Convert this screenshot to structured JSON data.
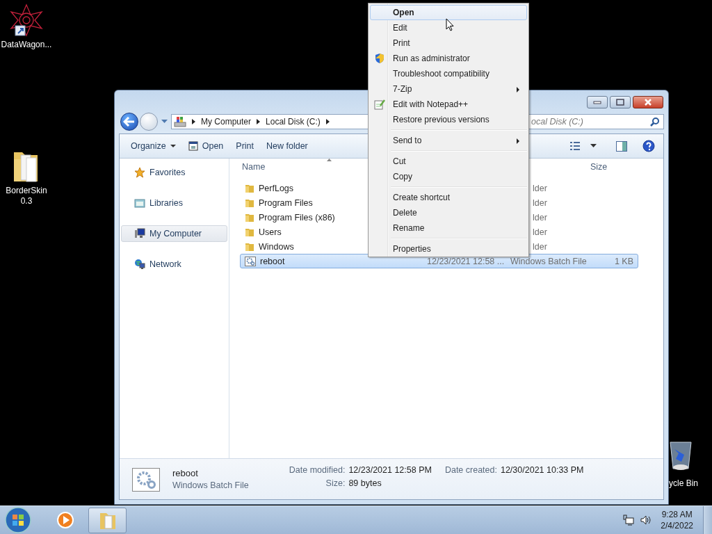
{
  "desktop_icons": [
    {
      "label": "DataWagon...",
      "kind": "shortcut"
    },
    {
      "label": "BorderSkin 0.3",
      "kind": "folder"
    },
    {
      "label": "ycle Bin",
      "kind": "recycle"
    }
  ],
  "window": {
    "crumbs": [
      "My Computer",
      "Local Disk (C:)"
    ],
    "search": {
      "placeholder": "ocal Disk (C:)"
    },
    "toolbar": [
      {
        "label": "Organize",
        "kind": "dropdown"
      },
      {
        "label": "Open",
        "kind": "icon"
      },
      {
        "label": "Print",
        "kind": "plain"
      },
      {
        "label": "New folder",
        "kind": "plain"
      }
    ],
    "nav": [
      {
        "label": "Favorites",
        "kind": "star",
        "selected": false
      },
      {
        "label": "Libraries",
        "kind": "library",
        "selected": false
      },
      {
        "label": "My Computer",
        "kind": "computer",
        "selected": true
      },
      {
        "label": "Network",
        "kind": "network",
        "selected": false
      }
    ],
    "columns": [
      "Name",
      "Size"
    ],
    "rows": [
      {
        "name": "PerfLogs",
        "kind": "folder",
        "selected": false,
        "type": "lder"
      },
      {
        "name": "Program Files",
        "kind": "folder",
        "selected": false,
        "type": "lder"
      },
      {
        "name": "Program Files (x86)",
        "kind": "folder",
        "selected": false,
        "type": "lder"
      },
      {
        "name": "Users",
        "kind": "folder",
        "selected": false,
        "type": "lder"
      },
      {
        "name": "Windows",
        "kind": "folder",
        "selected": false,
        "type": "lder"
      },
      {
        "name": "reboot",
        "kind": "batch",
        "selected": true,
        "date": "12/23/2021 12:58 ...",
        "type": "Windows Batch File",
        "size": "1 KB"
      }
    ],
    "details": {
      "name": "reboot",
      "type": "Windows Batch File",
      "fields": [
        {
          "label": "Date modified:",
          "value": "12/23/2021 12:58 PM"
        },
        {
          "label": "Date created:",
          "value": "12/30/2021 10:33 PM"
        },
        {
          "label": "Size:",
          "value": "89 bytes"
        }
      ]
    }
  },
  "menu": [
    {
      "kind": "item",
      "label": "Open",
      "selected": true
    },
    {
      "kind": "item",
      "label": "Edit",
      "selected": false
    },
    {
      "kind": "item",
      "label": "Print",
      "selected": false
    },
    {
      "kind": "admin",
      "label": "Run as administrator",
      "selected": false
    },
    {
      "kind": "item",
      "label": "Troubleshoot compatibility",
      "selected": false
    },
    {
      "kind": "submenu",
      "label": "7-Zip",
      "selected": false
    },
    {
      "kind": "editor",
      "label": "Edit with Notepad++",
      "selected": false
    },
    {
      "kind": "item",
      "label": "Restore previous versions",
      "selected": false
    },
    {
      "kind": "separator"
    },
    {
      "kind": "submenu",
      "label": "Send to",
      "selected": false
    },
    {
      "kind": "separator"
    },
    {
      "kind": "item",
      "label": "Cut",
      "selected": false
    },
    {
      "kind": "item",
      "label": "Copy",
      "selected": false
    },
    {
      "kind": "separator"
    },
    {
      "kind": "item",
      "label": "Create shortcut",
      "selected": false
    },
    {
      "kind": "item",
      "label": "Delete",
      "selected": false
    },
    {
      "kind": "item",
      "label": "Rename",
      "selected": false
    },
    {
      "kind": "separator"
    },
    {
      "kind": "item",
      "label": "Properties",
      "selected": false
    }
  ],
  "taskbar": {
    "buttons": [
      {
        "kind": "media",
        "selected": false
      },
      {
        "kind": "explorer",
        "selected": true
      }
    ],
    "time": "9:28 AM",
    "date": "2/4/2022"
  }
}
